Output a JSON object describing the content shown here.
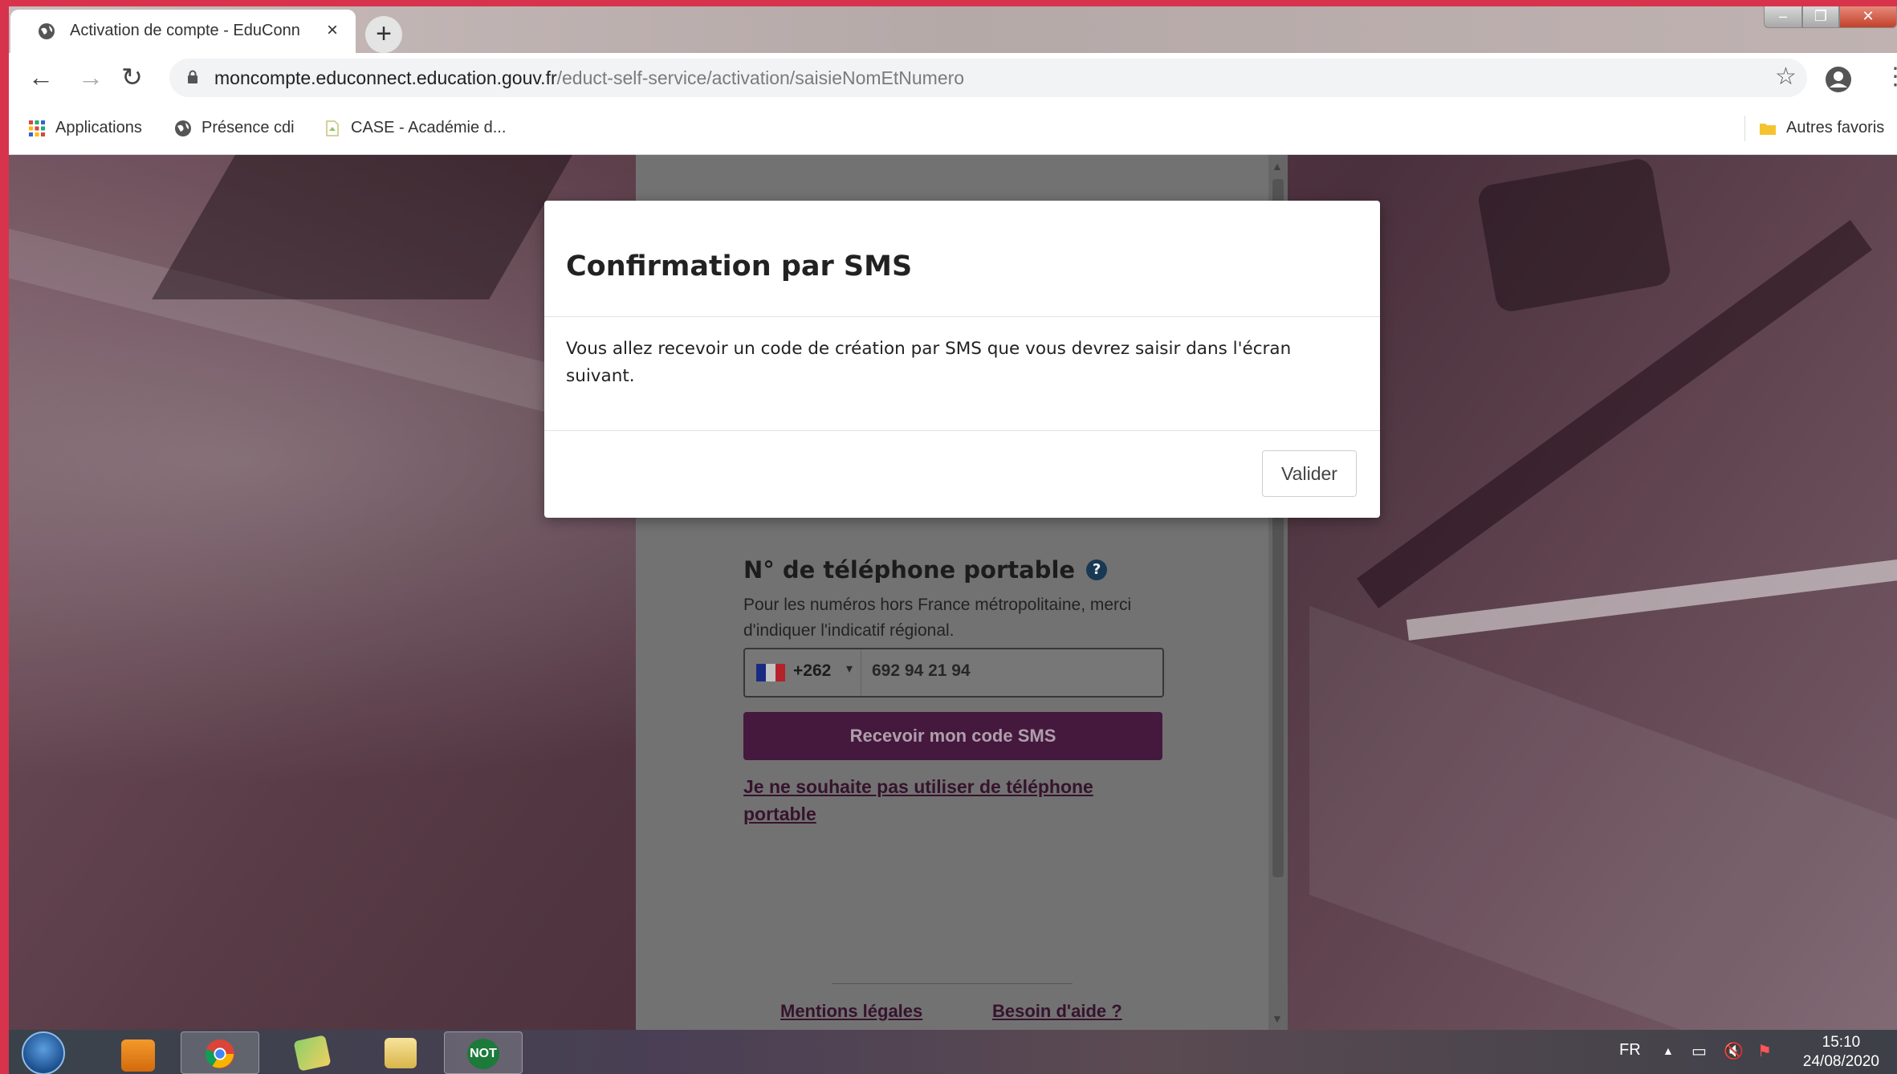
{
  "browser": {
    "tab_title": "Activation de compte - EduConn",
    "tab_close": "×",
    "new_tab": "+",
    "url_host": "moncompte.educonnect.education.gouv.fr",
    "url_path": "/educt-self-service/activation/saisieNomEtNumero",
    "bookmarks": [
      {
        "label": "Applications",
        "icon": "apps-grid-icon"
      },
      {
        "label": "Présence cdi",
        "icon": "globe-icon"
      },
      {
        "label": "CASE - Académie d...",
        "icon": "page-icon"
      }
    ],
    "other_bookmarks": "Autres favoris"
  },
  "page": {
    "phone_label": "N° de téléphone portable",
    "phone_hint": "Pour les numéros hors France métropolitaine, merci d'indiquer l'indicatif régional.",
    "dial_code": "+262",
    "phone_value": "692 94 21 94",
    "sms_button": "Recevoir mon code SMS",
    "no_phone_link": "Je ne souhaite pas utiliser de téléphone portable",
    "footer_links": [
      "Mentions légales",
      "Besoin d'aide ?"
    ]
  },
  "modal": {
    "title": "Confirmation par SMS",
    "body": "Vous allez recevoir un code de création par SMS que vous devrez saisir dans l'écran suivant.",
    "confirm_button": "Valider"
  },
  "taskbar": {
    "apps": [
      "media-player-icon",
      "chrome-icon",
      "folder-icon",
      "file-explorer-icon",
      "not-app-icon"
    ],
    "not_label": "NOT",
    "language": "FR",
    "time": "15:10",
    "date": "24/08/2020"
  },
  "colors": {
    "primary": "#4a1a42",
    "frame": "#d8334d"
  }
}
